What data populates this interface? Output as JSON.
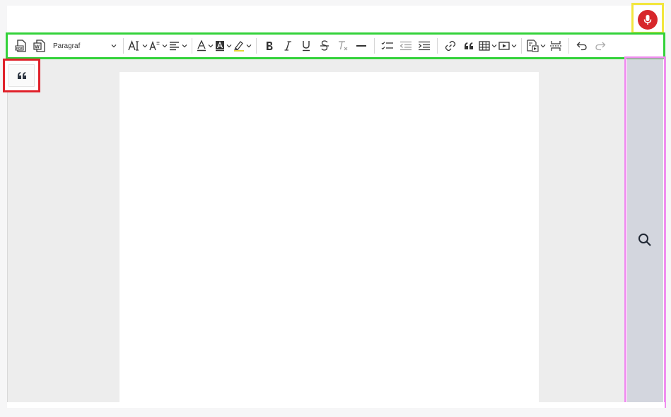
{
  "toolbar": {
    "paragraph_select": {
      "value": "Paragraf"
    }
  },
  "icons": {
    "mic": "microphone-icon",
    "quote": "quote-icon",
    "search": "search-icon"
  },
  "colors": {
    "mic_button": "#d7272b",
    "highlight_mic": "#f2e63d",
    "highlight_toolbar": "#33d23a",
    "highlight_quote": "#e0222b",
    "highlight_sidebar": "#f08ef0",
    "sidebar_bg": "#d3d6de"
  }
}
